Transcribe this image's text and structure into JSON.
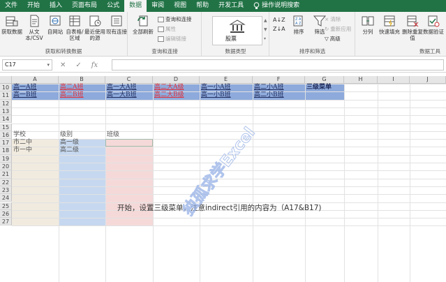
{
  "tabs": [
    "文件",
    "开始",
    "插入",
    "页面布局",
    "公式",
    "数据",
    "审阅",
    "视图",
    "帮助",
    "开发工具"
  ],
  "active_tab": "数据",
  "tell_me": "操作说明搜索",
  "ribbon": {
    "get_data": {
      "buttons": [
        "获取数据",
        "从文本/CSV",
        "自网站",
        "自表格/区域",
        "最近使用的源",
        "现有连接"
      ],
      "label": "获取和转换数据"
    },
    "queries": {
      "refresh_all": "全部刷新",
      "queries_connections": "查询和连接",
      "properties": "属性",
      "edit_links": "编辑链接",
      "label": "查询和连接"
    },
    "data_types": {
      "gallery_item": "股票",
      "label": "数据类型"
    },
    "sort_filter": {
      "sort": "排序",
      "filter": "筛选",
      "clear": "清除",
      "reapply": "重新应用",
      "advanced": "高级",
      "label": "排序和筛选"
    },
    "data_tools": {
      "text_to_columns": "分列",
      "flash_fill": "快速填充",
      "remove_duplicates": "删除重复值",
      "data_validation": "数据验证",
      "label": "数据工具"
    }
  },
  "formula_bar": {
    "name_box": "C17",
    "formula": ""
  },
  "columns": [
    "A",
    "B",
    "C",
    "D",
    "E",
    "F",
    "G",
    "H",
    "I",
    "J"
  ],
  "rows": [
    "10",
    "11",
    "12",
    "13",
    "14",
    "15",
    "16",
    "17",
    "18",
    "19",
    "20",
    "21",
    "22",
    "23",
    "24",
    "25",
    "26",
    "27"
  ],
  "cells": {
    "A10": "高一A班",
    "B10": "高二A班",
    "C10": "高一大A班",
    "D10": "高二大A级",
    "E10": "高一小A班",
    "F10": "高二小A班",
    "G10": "三级菜单",
    "A11": "高一B班",
    "B11": "高二B班",
    "C11": "高一大B班",
    "D11": "高二大B级",
    "E11": "高一小B班",
    "F11": "高二小B班",
    "A16": "学校",
    "B16": "级别",
    "C16": "班级",
    "A17": "市二中",
    "B17": "高一级",
    "A18": "市一中",
    "B18": "高二级"
  },
  "caption": "开始，设置三级菜单，注意indirect引用的内容为（A17&B17)",
  "watermark": "独孤求学Excel",
  "colors": {
    "ribbon_green": "#217346",
    "header_fill": "#8eaadc",
    "school_fill": "#f1ebdf",
    "level_fill": "#c6d8ef",
    "class_fill": "#f5d9d9",
    "accent_red": "#e0303a"
  }
}
